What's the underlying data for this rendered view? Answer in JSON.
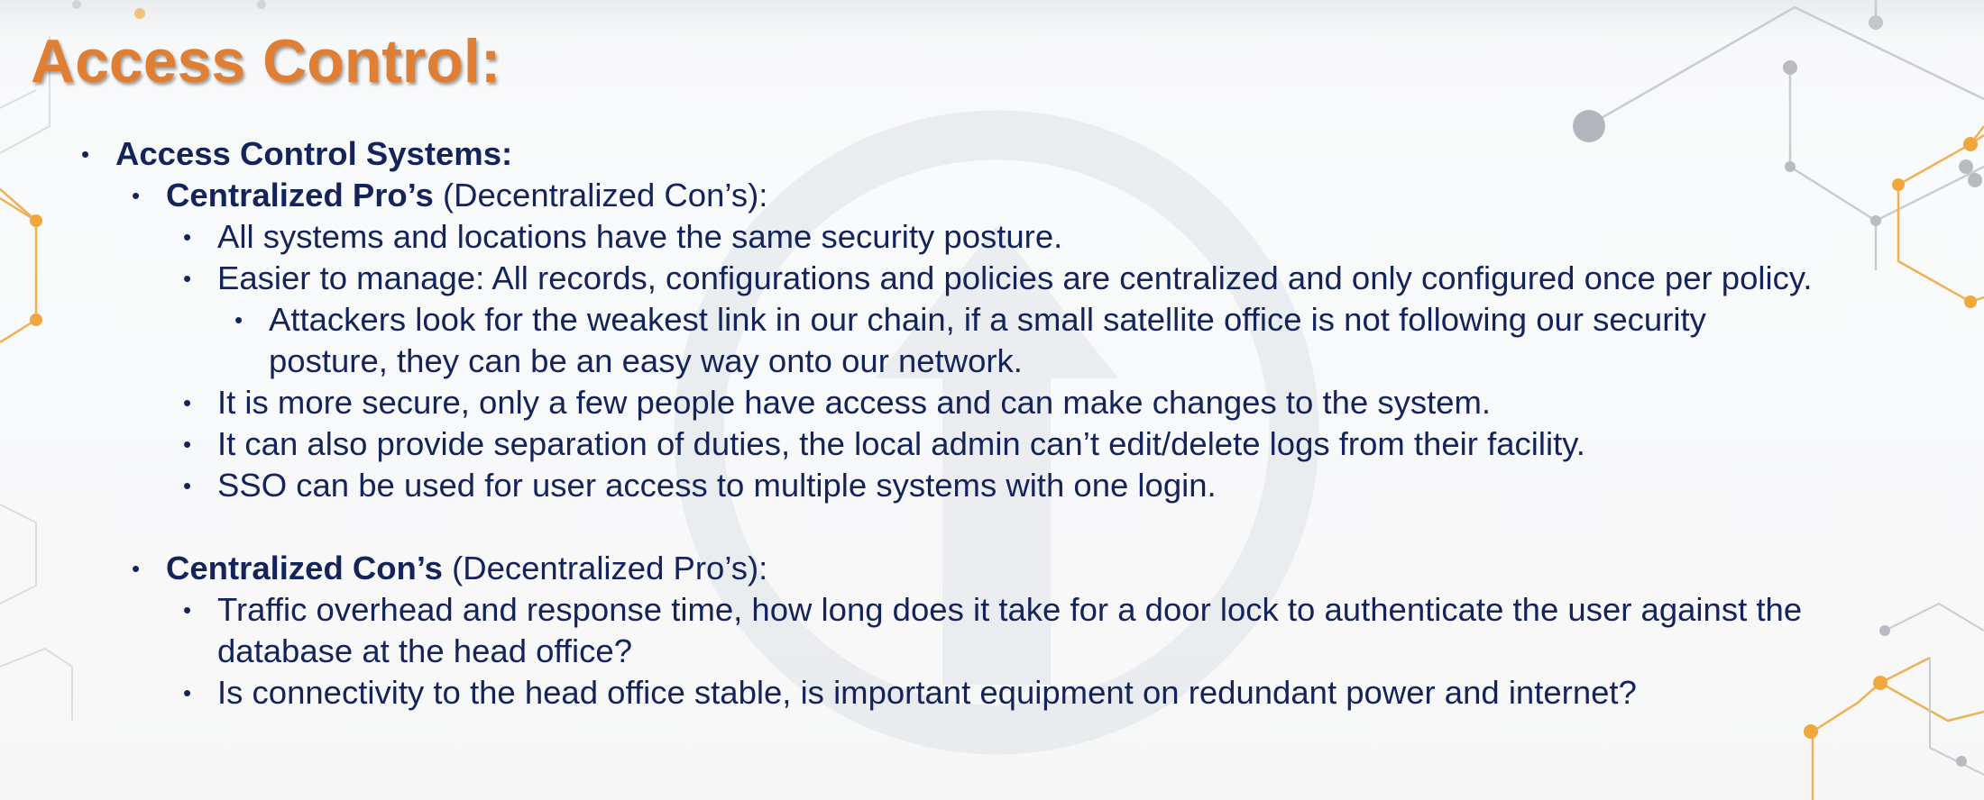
{
  "title": "Access Control:",
  "colors": {
    "title": "#e07f33",
    "text": "#14235a",
    "accent_orange": "#f0a83c",
    "accent_gray": "#b8bcc2"
  },
  "bullet_glyph": "•",
  "list": {
    "l1": {
      "bold": "Access Control Systems:"
    },
    "pros_header": {
      "bold": "Centralized Pro’s",
      "rest": " (Decentralized Con’s):"
    },
    "pros": [
      "All systems and locations have the same security posture.",
      "Easier to manage: All records, configurations and policies are centralized and only configured once per policy.",
      "It is more secure, only a few people have access and can make changes to the system.",
      "It can also provide separation of duties, the local admin can’t edit/delete logs from their facility.",
      "SSO can be used for user access to multiple systems with one login."
    ],
    "pros_sub": {
      "line1": "Attackers look for the weakest link in our chain, if a small satellite office is not following our security",
      "line2": "posture, they can be an easy way onto our network."
    },
    "cons_header": {
      "bold": "Centralized Con’s",
      "rest": " (Decentralized Pro’s):"
    },
    "cons": [
      {
        "line1": "Traffic overhead and response time, how long does it take for a door lock to authenticate the user against the",
        "line2": "database at the head office?"
      },
      {
        "line1": "Is connectivity to the head office stable, is important equipment on redundant power and internet?"
      }
    ]
  }
}
